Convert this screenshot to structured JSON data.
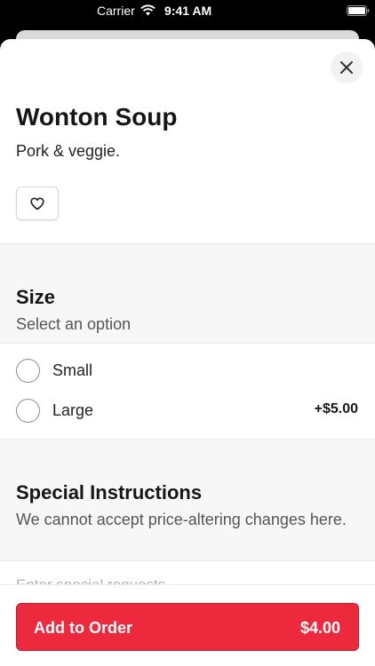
{
  "status_bar": {
    "carrier": "Carrier",
    "time": "9:41 AM"
  },
  "item": {
    "title": "Wonton Soup",
    "description": "Pork & veggie.",
    "favorite_icon": "heart-outline-icon",
    "close_icon": "close-icon"
  },
  "size_section": {
    "title": "Size",
    "subtitle": "Select an option",
    "options": [
      {
        "label": "Small",
        "price": "",
        "selected": false
      },
      {
        "label": "Large",
        "price": "+$5.00",
        "selected": false
      }
    ]
  },
  "instructions_section": {
    "title": "Special Instructions",
    "subtitle": "We cannot accept price-altering changes here.",
    "input_value": "",
    "input_placeholder": "Enter special requests"
  },
  "footer": {
    "button_label": "Add to Order",
    "button_price": "$4.00"
  },
  "colors": {
    "primary": "#ed2a3d",
    "background": "#ffffff",
    "section_background": "#f7f7f7"
  }
}
